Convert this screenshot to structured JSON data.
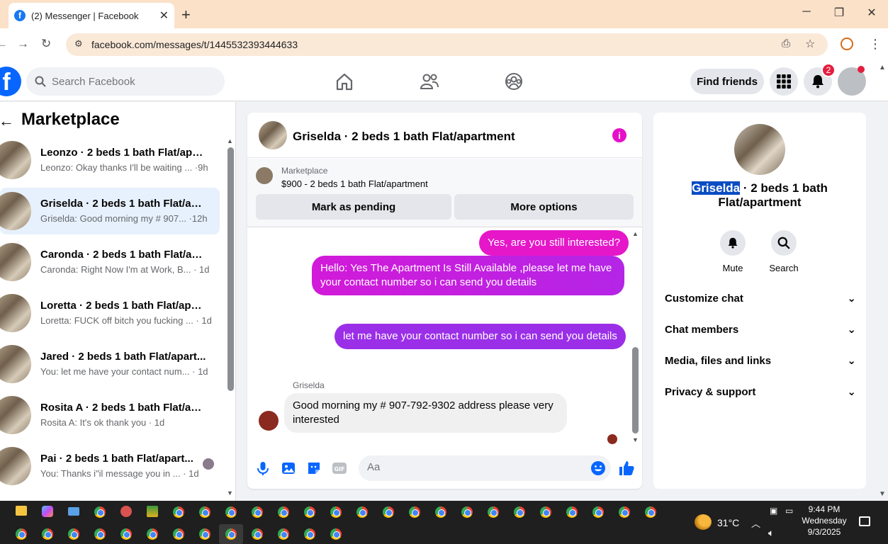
{
  "browser": {
    "tab_title": "(2) Messenger | Facebook",
    "url": "facebook.com/messages/t/1445532393444633"
  },
  "header": {
    "search_placeholder": "Search Facebook",
    "find_friends": "Find friends",
    "notif_count": "2"
  },
  "sidebar": {
    "title": "Marketplace",
    "items": [
      {
        "name": "Leonzo · 2 beds 1 bath Flat/apar...",
        "preview": "Leonzo: Okay thanks I'll be waiting ... ·9h"
      },
      {
        "name": "Griselda · 2 beds 1 bath Flat/apa...",
        "preview": "Griselda: Good morning my # 907... ·12h"
      },
      {
        "name": "Caronda · 2 beds 1 bath Flat/apa...",
        "preview": "Caronda: Right Now I'm at Work, B... · 1d"
      },
      {
        "name": "Loretta · 2 beds 1 bath Flat/apar...",
        "preview": "Loretta: FUCK off bitch you fucking ... · 1d"
      },
      {
        "name": "Jared · 2 beds 1 bath Flat/apart...",
        "preview": "You: let me have your contact num... · 1d"
      },
      {
        "name": "Rosita A · 2 beds 1 bath Flat/apa...",
        "preview": "Rosita A: It's ok thank you · 1d"
      },
      {
        "name": "Pai · 2 beds 1 bath Flat/apart...",
        "preview": "You: Thanks i\"il message you in ... · 1d"
      }
    ]
  },
  "chat": {
    "title": "Griselda · 2 beds 1 bath Flat/apartment",
    "mp_label": "Marketplace",
    "mp_price": "$900 - 2 beds 1 bath Flat/apartment",
    "mark_pending": "Mark as pending",
    "more_options": "More options",
    "msg1": "Yes, are you still interested?",
    "msg2": "Hello: Yes The Apartment Is Still Available ,please let me have your contact number so i can send you details",
    "msg3": "let me have your contact number so i can send you details",
    "sender": "Griselda",
    "msg4": "Good morning my # 907-792-9302 address please very interested",
    "composer_placeholder": "Aa"
  },
  "right": {
    "name_hl": "Griselda",
    "name_rest": " · 2 beds 1 bath Flat/apartment",
    "mute": "Mute",
    "search": "Search",
    "rows": [
      "Customize chat",
      "Chat members",
      "Media, files and links",
      "Privacy & support"
    ]
  },
  "taskbar": {
    "temp": "31°C",
    "time": "9:44 PM",
    "day": "Wednesday",
    "date": "9/3/2025"
  }
}
